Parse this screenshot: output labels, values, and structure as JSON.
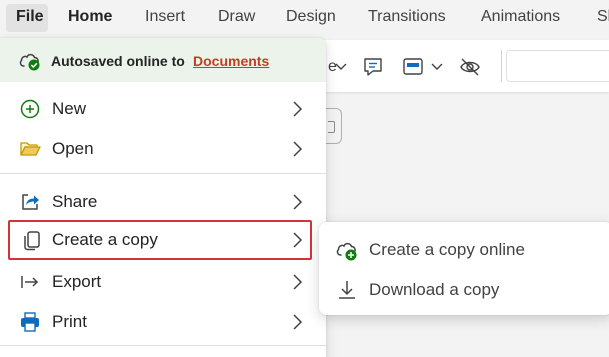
{
  "ribbon": {
    "tabs": [
      {
        "label": "File",
        "icon": null
      },
      {
        "label": "Home"
      },
      {
        "label": "Insert"
      },
      {
        "label": "Draw"
      },
      {
        "label": "Design"
      },
      {
        "label": "Transitions"
      },
      {
        "label": "Animations"
      },
      {
        "label": "Sl"
      }
    ],
    "selected_tab": "Home",
    "toolbar_fragment": "e",
    "toolbar_icons": [
      "dropdown-chevron-icon",
      "comment-icon",
      "layout-icon",
      "dropdown-chevron-icon",
      "hide-icon"
    ]
  },
  "file_menu": {
    "autosave": {
      "text": "Autosaved online to",
      "link": "Documents",
      "icon": "cloud-check-icon",
      "link_color": "#c43e1c",
      "background": "#ebf3eb"
    },
    "items": [
      {
        "label": "New",
        "icon": "plus-circle-icon"
      },
      {
        "label": "Open",
        "icon": "folder-open-icon"
      },
      {
        "label": "Share",
        "icon": "share-icon"
      },
      {
        "label": "Create a copy",
        "icon": "copy-icon",
        "highlighted": true
      },
      {
        "label": "Export",
        "icon": "export-arrow-icon"
      },
      {
        "label": "Print",
        "icon": "printer-icon"
      }
    ],
    "highlight_color": "#d13438"
  },
  "submenu": {
    "items": [
      {
        "label": "Create a copy online",
        "icon": "cloud-add-icon"
      },
      {
        "label": "Download a copy",
        "icon": "download-icon"
      }
    ]
  }
}
